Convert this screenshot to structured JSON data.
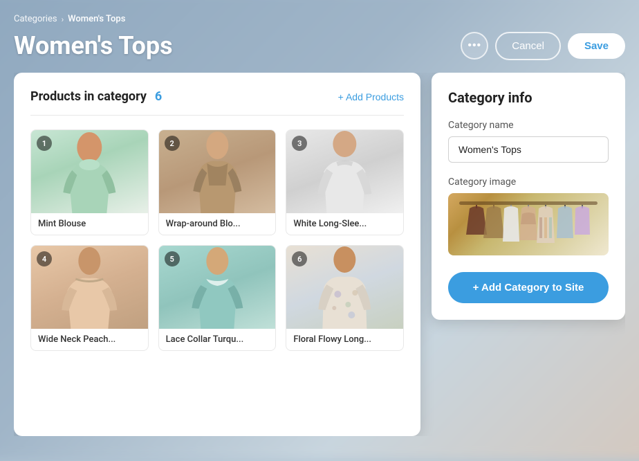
{
  "breadcrumb": {
    "parent": "Categories",
    "chevron": "›",
    "current": "Women's Tops"
  },
  "header": {
    "title": "Women's Tops",
    "more_label": "•••",
    "cancel_label": "Cancel",
    "save_label": "Save"
  },
  "products_panel": {
    "title": "Products in category",
    "count": "6",
    "add_label": "+ Add Products",
    "products": [
      {
        "id": 1,
        "name": "Mint Blouse",
        "img_class": "img-mint"
      },
      {
        "id": 2,
        "name": "Wrap-around Blo...",
        "img_class": "img-wrap"
      },
      {
        "id": 3,
        "name": "White Long-Slee...",
        "img_class": "img-white"
      },
      {
        "id": 4,
        "name": "Wide Neck Peach...",
        "img_class": "img-peach"
      },
      {
        "id": 5,
        "name": "Lace Collar Turqu...",
        "img_class": "img-turq"
      },
      {
        "id": 6,
        "name": "Floral Flowy Long...",
        "img_class": "img-floral"
      }
    ]
  },
  "category_panel": {
    "title": "Category info",
    "name_label": "Category name",
    "name_value": "Women's Tops",
    "image_label": "Category image",
    "add_button_label": "+ Add Category to Site"
  }
}
